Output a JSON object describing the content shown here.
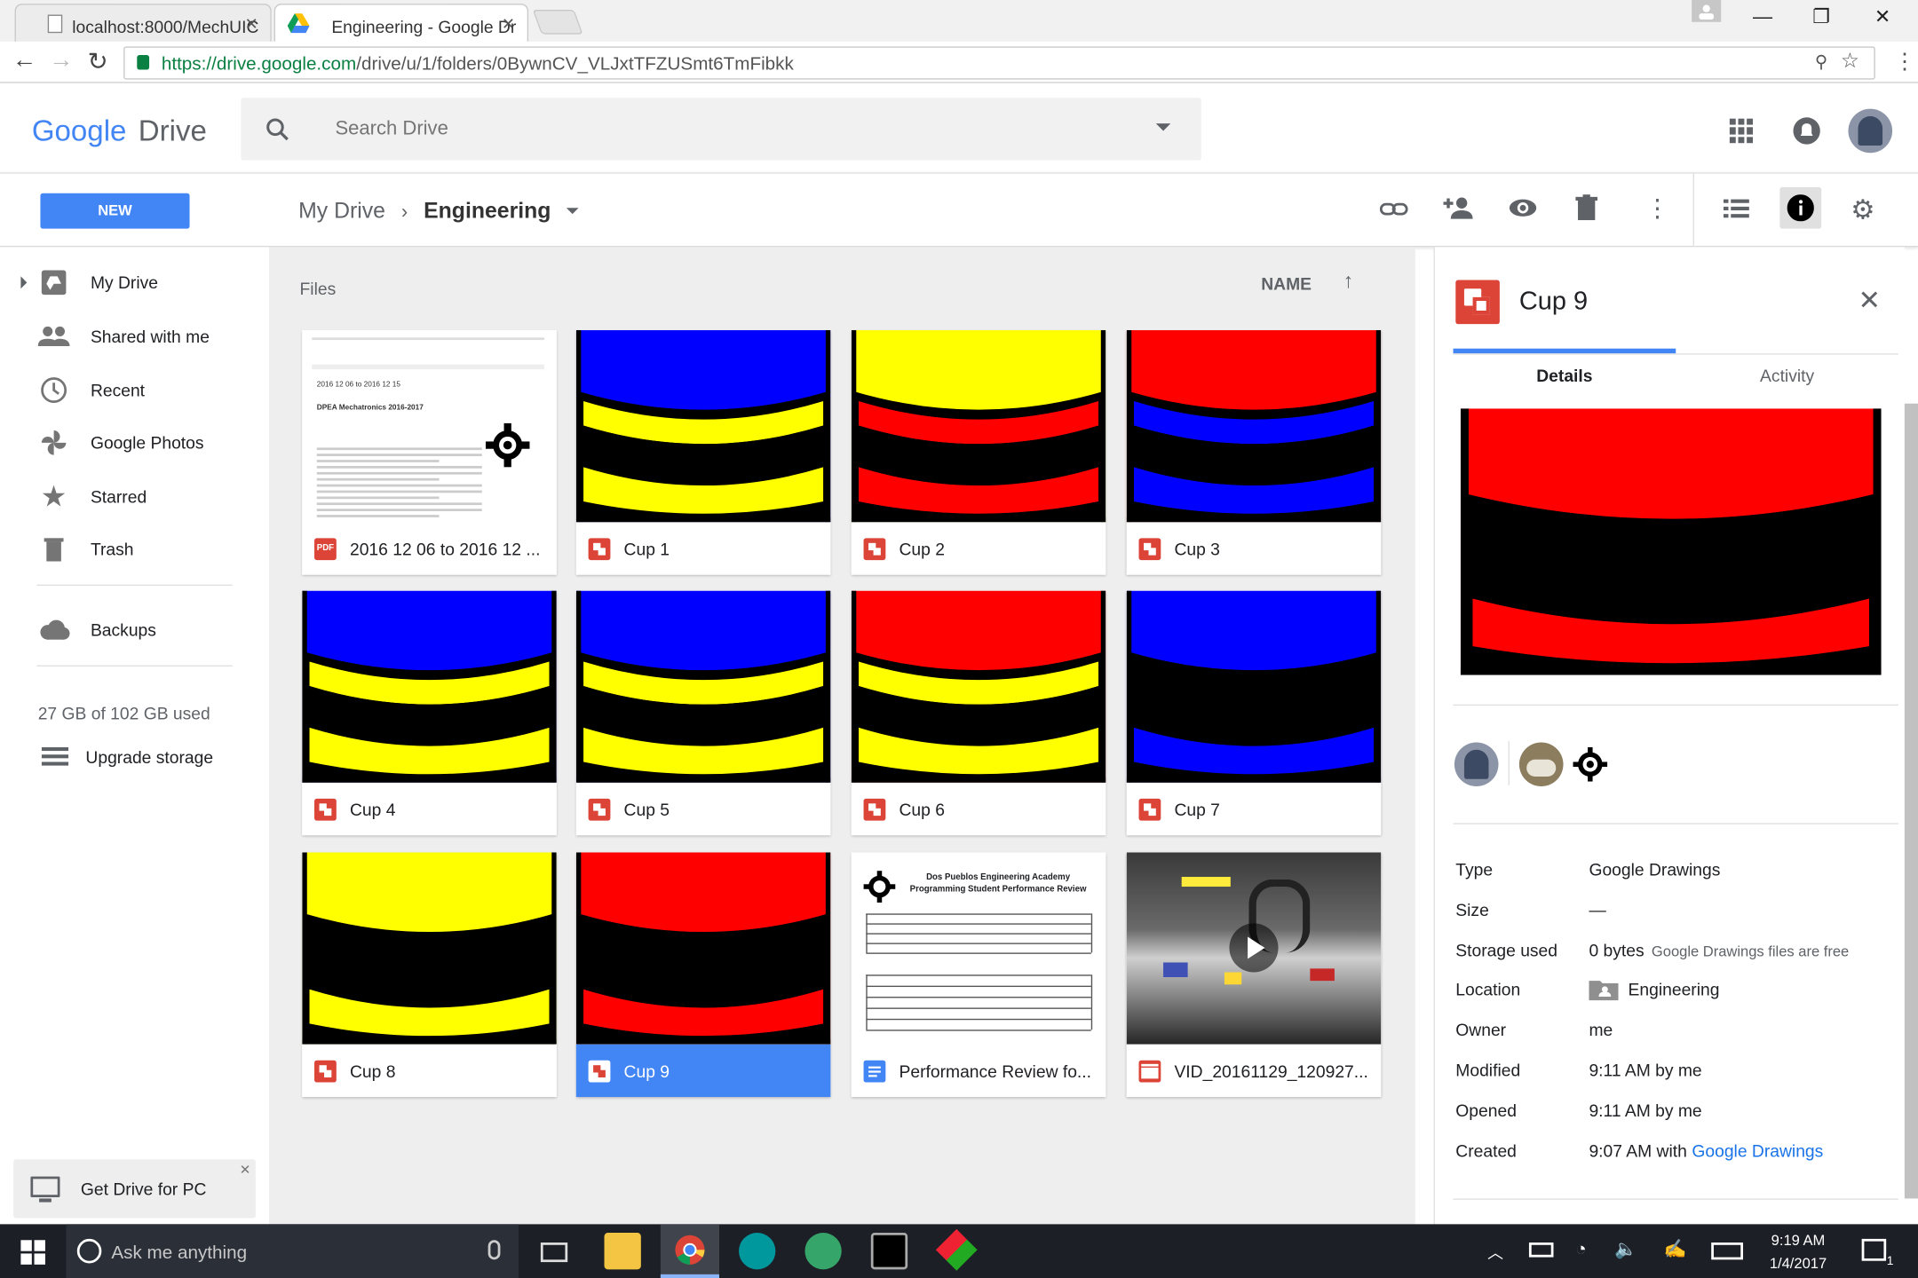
{
  "browser": {
    "tabs": [
      {
        "title": "localhost:8000/MechUIC"
      },
      {
        "title": "Engineering - Google Dr"
      }
    ],
    "url_host": "https://drive.google.com",
    "url_path": "/drive/u/1/folders/0BywnCV_VLJxtTFZUSmt6TmFibkk"
  },
  "app": {
    "logo_google": "Google",
    "logo_drive": "Drive",
    "search_placeholder": "Search Drive",
    "new_label": "NEW",
    "breadcrumb_root": "My Drive",
    "breadcrumb_current": "Engineering"
  },
  "sidebar": {
    "items": [
      {
        "label": "My Drive",
        "icon": "drive-icon"
      },
      {
        "label": "Shared with me",
        "icon": "people-icon"
      },
      {
        "label": "Recent",
        "icon": "clock-icon"
      },
      {
        "label": "Google Photos",
        "icon": "pinwheel-icon"
      },
      {
        "label": "Starred",
        "icon": "star-icon"
      },
      {
        "label": "Trash",
        "icon": "trash-icon"
      }
    ],
    "backups": "Backups",
    "storage_used": "27 GB of 102 GB used",
    "upgrade": "Upgrade storage",
    "get_drive": "Get Drive for PC"
  },
  "files": {
    "section_label": "Files",
    "sort_label": "NAME",
    "items": [
      {
        "name": "2016 12 06 to 2016 12 ...",
        "kind": "pdf",
        "bands": []
      },
      {
        "name": "Cup 1",
        "kind": "drawing",
        "bands": [
          "#0000ff",
          "#ffff00",
          "#000000",
          "#ffff00",
          "#000000"
        ]
      },
      {
        "name": "Cup 2",
        "kind": "drawing",
        "bands": [
          "#ffff00",
          "#ff0000",
          "#000000",
          "#ff0000",
          "#000000"
        ]
      },
      {
        "name": "Cup 3",
        "kind": "drawing",
        "bands": [
          "#ff0000",
          "#0000ff",
          "#000000",
          "#0000ff",
          "#000000"
        ]
      },
      {
        "name": "Cup 4",
        "kind": "drawing",
        "bands": [
          "#0000ff",
          "#ffff00",
          "#000000",
          "#ffff00",
          "#000000"
        ]
      },
      {
        "name": "Cup 5",
        "kind": "drawing",
        "bands": [
          "#0000ff",
          "#ffff00",
          "#000000",
          "#ffff00",
          "#000000"
        ]
      },
      {
        "name": "Cup 6",
        "kind": "drawing",
        "bands": [
          "#ff0000",
          "#ffff00",
          "#000000",
          "#ffff00",
          "#000000"
        ]
      },
      {
        "name": "Cup 7",
        "kind": "drawing",
        "bands": [
          "#0000ff",
          "#000000",
          "#000000",
          "#0000ff",
          "#000000"
        ]
      },
      {
        "name": "Cup 8",
        "kind": "drawing",
        "bands": [
          "#ffff00",
          "#000000",
          "#000000",
          "#ffff00",
          "#000000"
        ]
      },
      {
        "name": "Cup 9",
        "kind": "drawing",
        "bands": [
          "#ff0000",
          "#000000",
          "#000000",
          "#ff0000",
          "#000000"
        ],
        "selected": true
      },
      {
        "name": "Performance Review fo...",
        "kind": "doc",
        "bands": []
      },
      {
        "name": "VID_20161129_120927...",
        "kind": "video",
        "bands": []
      }
    ]
  },
  "pdf_preview": {
    "heading": "2016 12 06 to 2016 12 15",
    "subtitle": "DPEA Mechatronics 2016-2017"
  },
  "doc_preview": {
    "line1": "Dos Pueblos Engineering Academy",
    "line2": "Programming Student Performance Review"
  },
  "details": {
    "title": "Cup 9",
    "tab_details": "Details",
    "tab_activity": "Activity",
    "preview_bands": [
      "#ff0000",
      "#000000",
      "#000000",
      "#ff0000",
      "#000000"
    ],
    "rows": [
      {
        "key": "Type",
        "value": "Google Drawings"
      },
      {
        "key": "Size",
        "value": "—"
      },
      {
        "key": "Storage used",
        "value": "0 bytes",
        "note": "Google Drawings files are free"
      },
      {
        "key": "Location",
        "value": "Engineering"
      },
      {
        "key": "Owner",
        "value": "me"
      },
      {
        "key": "Modified",
        "value": "9:11 AM by me"
      },
      {
        "key": "Opened",
        "value": "9:11 AM by me"
      },
      {
        "key": "Created",
        "value": "9:07 AM with",
        "link": "Google Drawings"
      }
    ]
  },
  "taskbar": {
    "cortana": "Ask me anything",
    "time": "9:19 AM",
    "date": "1/4/2017",
    "notif_count": "1"
  },
  "colors": {
    "accent": "#4285f4",
    "drawing": "#db4437"
  }
}
